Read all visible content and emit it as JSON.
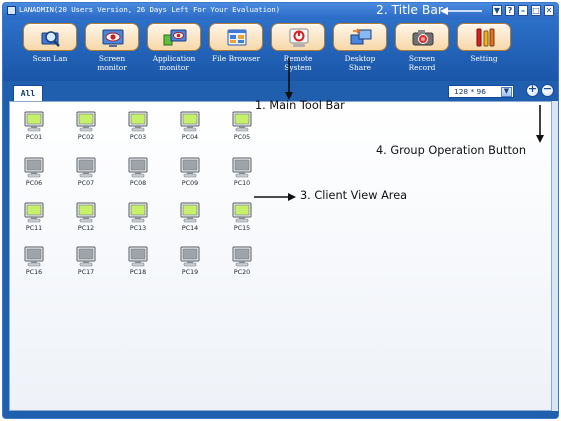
{
  "window": {
    "title": "LANADMIN(20 Users Version, 26 Days Left For Your Evaluation)",
    "buttons": [
      "▼",
      "?",
      "–",
      "□",
      "✕"
    ]
  },
  "toolbar": {
    "items": [
      {
        "label": "Scan Lan",
        "icon": "magnifier-icon"
      },
      {
        "label": "Screen\nmonitor",
        "icon": "eye-monitor-icon"
      },
      {
        "label": "Application\nmonitor",
        "icon": "app-monitor-icon"
      },
      {
        "label": "File Browser",
        "icon": "file-browser-icon"
      },
      {
        "label": "Remote\nSystem",
        "icon": "power-icon"
      },
      {
        "label": "Desktop\nShare",
        "icon": "desktop-share-icon"
      },
      {
        "label": "Screen\nRecord",
        "icon": "camera-icon"
      },
      {
        "label": "Setting",
        "icon": "tools-icon"
      }
    ]
  },
  "tabs": [
    {
      "label": "All",
      "active": true
    }
  ],
  "view_size": {
    "selected": "128 * 96"
  },
  "group_buttons": {
    "add": "+",
    "remove": "−"
  },
  "clients": [
    "PC01",
    "PC02",
    "PC03",
    "PC04",
    "PC05",
    "PC06",
    "PC07",
    "PC08",
    "PC09",
    "PC10",
    "PC11",
    "PC12",
    "PC13",
    "PC14",
    "PC15",
    "PC16",
    "PC17",
    "PC18",
    "PC19",
    "PC20"
  ],
  "client_status": [
    "online",
    "online",
    "online",
    "online",
    "online",
    "offline",
    "offline",
    "offline",
    "offline",
    "offline",
    "online",
    "online",
    "online",
    "online",
    "online",
    "offline",
    "offline",
    "offline",
    "offline",
    "offline"
  ],
  "annotations": {
    "title_bar": "2. Title Bar",
    "main_tool_bar": "1. Main Tool Bar",
    "group_operation": "4. Group Operation Button",
    "client_view": "3. Client View Area"
  },
  "colors": {
    "online_screen": "#c7f06a",
    "offline_screen": "#9ea4aa",
    "window_blue": "#1f5fae"
  }
}
